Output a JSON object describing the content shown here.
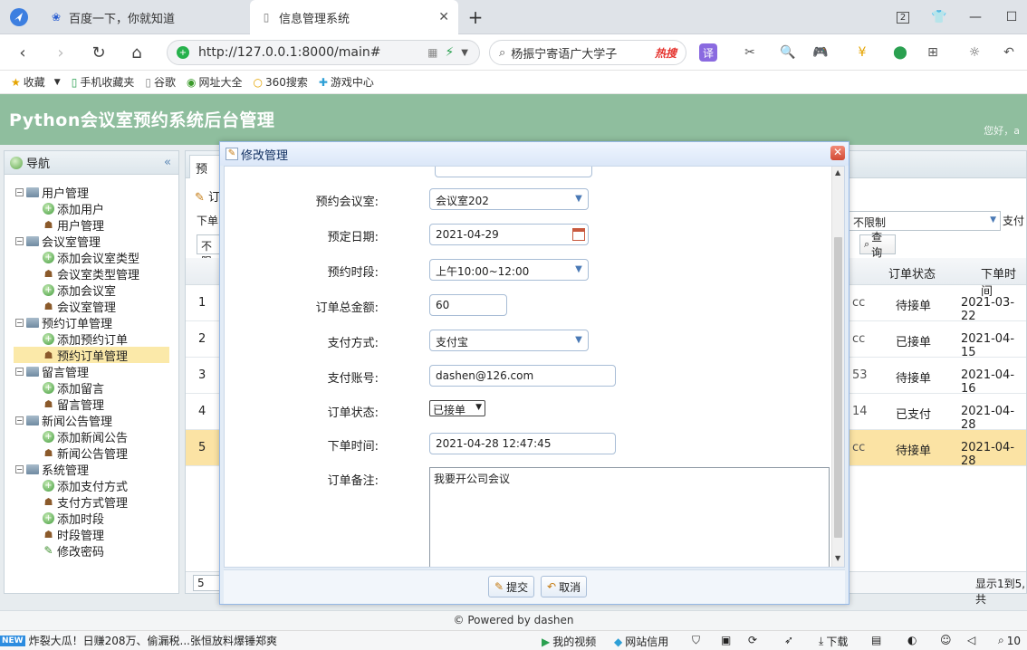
{
  "browser": {
    "tabs": [
      {
        "title": "百度一下，你就知道",
        "icon": "paw-icon"
      },
      {
        "title": "信息管理系统",
        "icon": "page-icon"
      }
    ],
    "new_tab": "+",
    "window_controls": [
      "2"
    ],
    "url": "http://127.0.0.1:8000/main#",
    "search_text": "杨振宁寄语广大学子",
    "search_hot": "热搜",
    "translate": "译"
  },
  "bookmarks": [
    "收藏",
    "手机收藏夹",
    "谷歌",
    "网址大全",
    "360搜索",
    "游戏中心"
  ],
  "app": {
    "title": "Python会议室预约系统后台管理",
    "greeting": "您好，a",
    "footer": "© Powered by dashen"
  },
  "sidebar": {
    "title": "导航",
    "groups": [
      {
        "label": "用户管理",
        "items": [
          {
            "label": "添加用户",
            "type": "add"
          },
          {
            "label": "用户管理",
            "type": "user"
          }
        ]
      },
      {
        "label": "会议室管理",
        "items": [
          {
            "label": "添加会议室类型",
            "type": "add"
          },
          {
            "label": "会议室类型管理",
            "type": "user"
          },
          {
            "label": "添加会议室",
            "type": "add"
          },
          {
            "label": "会议室管理",
            "type": "user"
          }
        ]
      },
      {
        "label": "预约订单管理",
        "items": [
          {
            "label": "添加预约订单",
            "type": "add"
          },
          {
            "label": "预约订单管理",
            "type": "user",
            "selected": true
          }
        ]
      },
      {
        "label": "留言管理",
        "items": [
          {
            "label": "添加留言",
            "type": "add"
          },
          {
            "label": "留言管理",
            "type": "user"
          }
        ]
      },
      {
        "label": "新闻公告管理",
        "items": [
          {
            "label": "添加新闻公告",
            "type": "add"
          },
          {
            "label": "新闻公告管理",
            "type": "user"
          }
        ]
      },
      {
        "label": "系统管理",
        "items": [
          {
            "label": "添加支付方式",
            "type": "add"
          },
          {
            "label": "支付方式管理",
            "type": "user"
          },
          {
            "label": "添加时段",
            "type": "add"
          },
          {
            "label": "时段管理",
            "type": "user"
          },
          {
            "label": "修改密码",
            "type": "pen"
          }
        ]
      }
    ]
  },
  "main": {
    "tab_fragment": "预",
    "toolbar_fragment": "订",
    "filter_fragment": "下单",
    "filter_select_fragment": "不限",
    "filter_select": "不限制",
    "filter_right": "支付",
    "query": "查询",
    "columns": [
      "订单状态",
      "下单时间"
    ],
    "rows": [
      {
        "no": "1",
        "acct": "cc",
        "status": "待接单",
        "time": "2021-03-22"
      },
      {
        "no": "2",
        "acct": "cc",
        "status": "已接单",
        "time": "2021-04-15"
      },
      {
        "no": "3",
        "acct": "53",
        "status": "待接单",
        "time": "2021-04-16"
      },
      {
        "no": "4",
        "acct": "14",
        "status": "已支付",
        "time": "2021-04-28"
      },
      {
        "no": "5",
        "acct": "cc",
        "status": "待接单",
        "time": "2021-04-28"
      }
    ],
    "page_size": "5",
    "pager_info": "显示1到5,共"
  },
  "modal": {
    "title": "修改管理",
    "fields": {
      "room_label": "预约会议室:",
      "room_value": "会议室202",
      "date_label": "预定日期:",
      "date_value": "2021-04-29",
      "slot_label": "预约时段:",
      "slot_value": "上午10:00~12:00",
      "amount_label": "订单总金额:",
      "amount_value": "60",
      "pay_label": "支付方式:",
      "pay_value": "支付宝",
      "account_label": "支付账号:",
      "account_value": "dashen@126.com",
      "status_label": "订单状态:",
      "status_value": "已接单",
      "time_label": "下单时间:",
      "time_value": "2021-04-28 12:47:45",
      "remark_label": "订单备注:",
      "remark_value": "我要开公司会议"
    },
    "submit": "提交",
    "cancel": "取消"
  },
  "statusbar": {
    "badge": "NEW",
    "news": "炸裂大瓜！日赚208万、偷漏税...张恒放料爆锤郑爽",
    "items": [
      "我的视频",
      "网站信用",
      "下载",
      "10"
    ]
  }
}
